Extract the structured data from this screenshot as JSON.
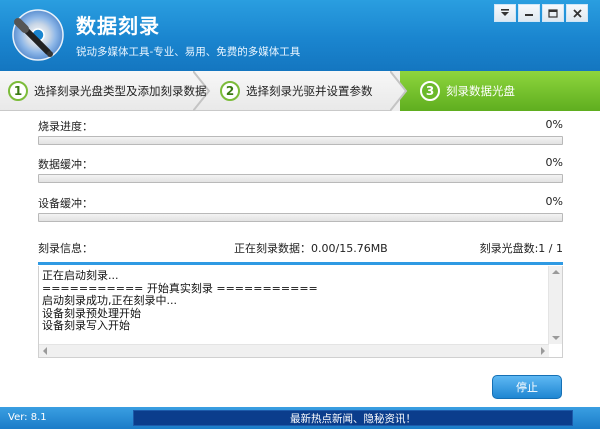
{
  "app": {
    "title": "数据刻录",
    "subtitle": "锐动多媒体工具-专业、易用、免费的多媒体工具"
  },
  "window_controls": {
    "icons": [
      "menu-icon",
      "minimize-icon",
      "maximize-icon",
      "close-icon"
    ]
  },
  "steps": [
    {
      "num": "1",
      "label": "选择刻录光盘类型及添加刻录数据"
    },
    {
      "num": "2",
      "label": "选择刻录光驱并设置参数"
    },
    {
      "num": "3",
      "label": "刻录数据光盘"
    }
  ],
  "progress": {
    "burn": {
      "label": "烧录进度：",
      "value": "0%",
      "fraction": 0
    },
    "data_buffer": {
      "label": "数据缓冲：",
      "value": "0%",
      "fraction": 0
    },
    "device_buffer": {
      "label": "设备缓冲：",
      "value": "0%",
      "fraction": 0
    }
  },
  "info": {
    "label": "刻录信息：",
    "status": "正在刻录数据：0.00/15.76MB",
    "disc_count": "刻录光盘数:1 / 1"
  },
  "log": {
    "lines": [
      "正在启动刻录...",
      "=========== 开始真实刻录 ===========",
      "启动刻录成功,正在刻录中...",
      "设备刻录预处理开始",
      "设备刻录写入开始"
    ]
  },
  "buttons": {
    "stop": "停止"
  },
  "footer": {
    "version": "Ver: 8.1",
    "news": "最新热点新闻、隐秘资讯！"
  },
  "colors": {
    "accent": "#1a85cf",
    "step_active": "#6bb92b"
  }
}
